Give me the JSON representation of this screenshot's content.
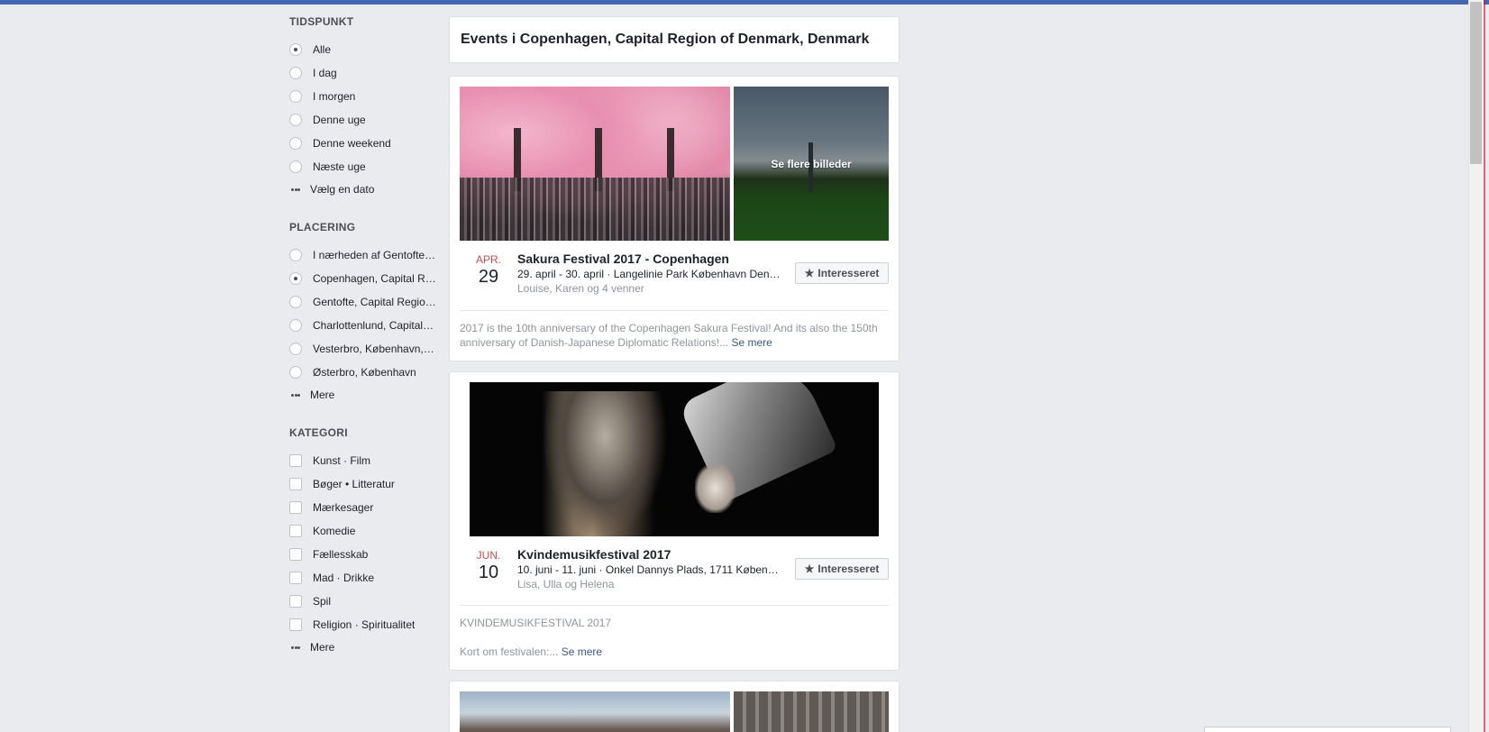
{
  "sidebar": {
    "time": {
      "title": "TIDSPUNKT",
      "options": [
        "Alle",
        "I dag",
        "I morgen",
        "Denne uge",
        "Denne weekend",
        "Næste uge"
      ],
      "selected_index": 0,
      "more_label": "Vælg en dato"
    },
    "location": {
      "title": "PLACERING",
      "options": [
        "I nærheden af Gentofte…",
        "Copenhagen, Capital R…",
        "Gentofte, Capital Regio…",
        "Charlottenlund, Capital…",
        "Vesterbro, København,…",
        "Østerbro, København"
      ],
      "selected_index": 1,
      "more_label": "Mere"
    },
    "category": {
      "title": "KATEGORI",
      "options": [
        "Kunst · Film",
        "Bøger • Litteratur",
        "Mærkesager",
        "Komedie",
        "Fællesskab",
        "Mad · Drikke",
        "Spil",
        "Religion · Spiritualitet"
      ],
      "more_label": "Mere"
    }
  },
  "header": {
    "title": "Events i Copenhagen, Capital Region of Denmark, Denmark"
  },
  "events": [
    {
      "month": "APR.",
      "day": "29",
      "title": "Sakura Festival 2017 - Copenhagen",
      "meta": "29. april - 30. april · Langelinie Park København Den…",
      "friends": "Louise, Karen og 4 venner",
      "interested_label": "Interesseret",
      "more_photos_label": "Se flere billeder",
      "description": "2017 is the 10th anniversary of the Copenhagen Sakura Festival! And its also the 150th anniversary of Danish-Japanese Diplomatic Relations!...",
      "see_more": "Se mere"
    },
    {
      "month": "JUN.",
      "day": "10",
      "title": "Kvindemusikfestival 2017",
      "meta": "10. juni - 11. juni · Onkel Dannys Plads, 1711 Køben…",
      "friends": "Lisa, Ulla og Helena",
      "interested_label": "Interesseret",
      "description_line1": "KVINDEMUSIKFESTIVAL 2017",
      "description_line2": "Kort om festivalen:...",
      "see_more": "Se mere"
    }
  ],
  "icons": {
    "star": "star-icon",
    "dots": "more-dots-icon"
  },
  "colors": {
    "topbar": "#4267b2",
    "background": "#e9ebee",
    "month": "#d24b4b",
    "link": "#365899"
  }
}
